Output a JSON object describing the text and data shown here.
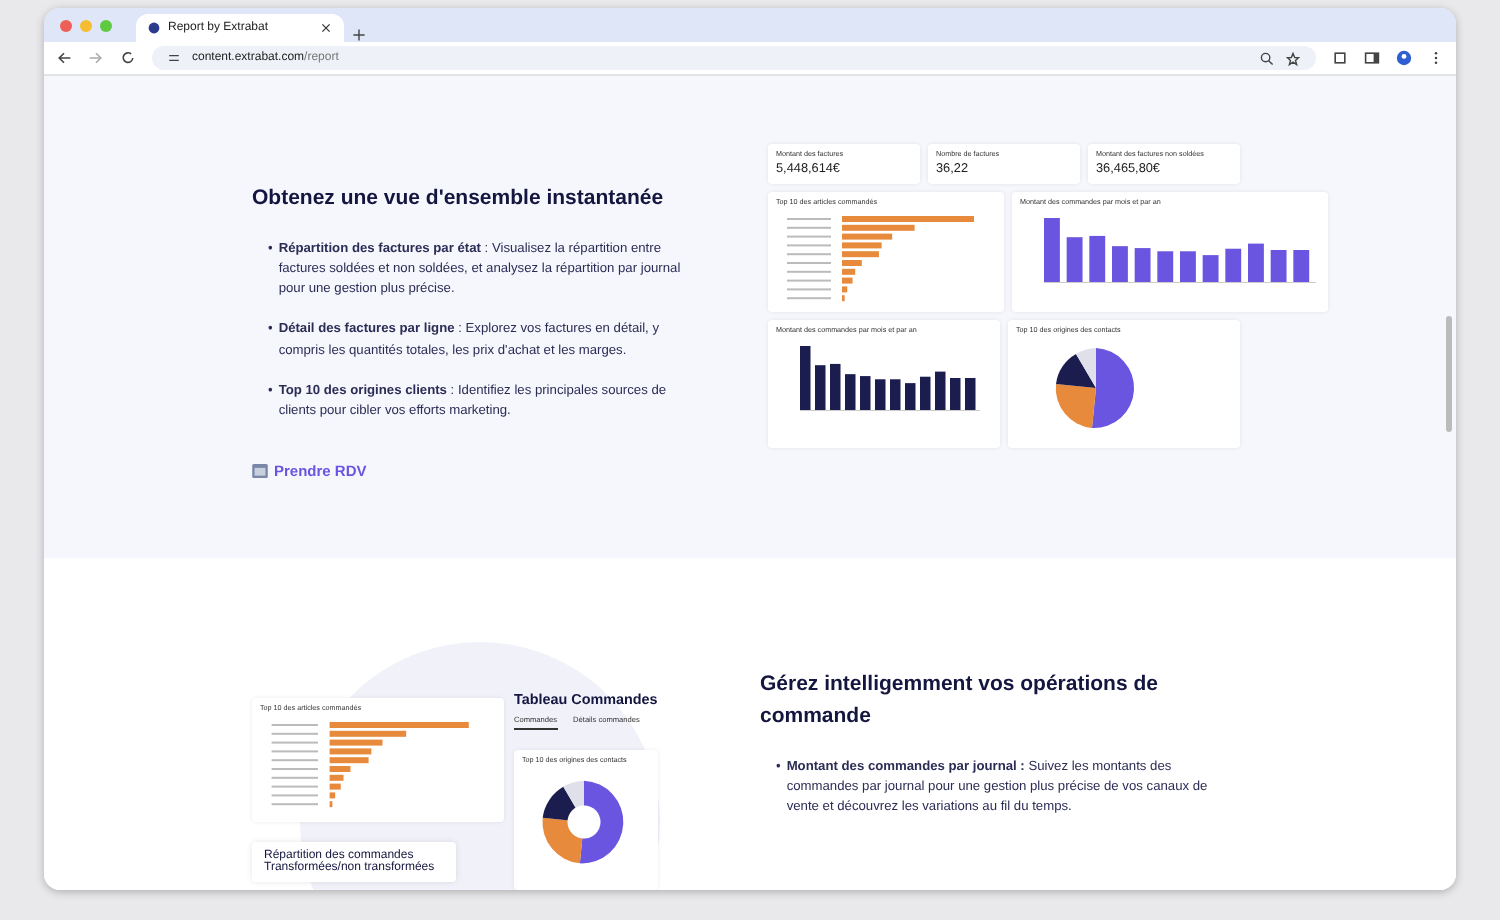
{
  "browser": {
    "tab_title": "Report by Extrabat",
    "url_host": "content.extrabat.com",
    "url_path": "/report"
  },
  "section1": {
    "title": "Obtenez une vue d'ensemble instantanée",
    "bullets": [
      {
        "marker": "•",
        "text": "**Répartition des factures par état** : Visualisez la répartition entre factures soldées et non soldées, et analysez la répartition par journal pour une gestion plus précise."
      },
      {
        "marker": "•",
        "text": "**Détail des factures par ligne** : Explorez vos factures en détail, y compris les quantités totales, les prix d'achat et les marges."
      },
      {
        "marker": "•",
        "text": "**Top 10 des origines clients** : Identifiez les principales sources de clients pour cibler vos efforts marketing."
      }
    ],
    "cta": "Prendre RDV",
    "dashboard": {
      "kpis": [
        {
          "label": "Montant des factures",
          "value": "5,448,614€"
        },
        {
          "label": "Nombre de factures",
          "value": "36,22"
        },
        {
          "label": "Montant des factures non soldées",
          "value": "36,465,80€"
        }
      ],
      "charts": [
        {
          "kind": "hbar",
          "title": "Top 10 des articles commandés"
        },
        {
          "kind": "vbar",
          "title": "Montant des commandes par mois et par an"
        },
        {
          "kind": "vbar_dark",
          "title": "Montant des commandes par mois et par an"
        },
        {
          "kind": "pie",
          "title": "Top 10 des origines des contacts"
        }
      ]
    }
  },
  "section2": {
    "title": "Gérez intelligemment vos opérations de commande",
    "bullets": [
      {
        "marker": "•",
        "text": "**Montant des commandes par journal :** Suivez les montants des commandes par journal pour une gestion plus précise de vos canaux de vente et découvrez les variations au fil du temps."
      }
    ],
    "preview": {
      "bar_chart_title": "Top 10 des articles commandés",
      "table_title": "Tableau Commandes",
      "tabs": [
        {
          "label": "Commandes",
          "selected": true
        },
        {
          "label": "Détails commandes",
          "selected": false
        }
      ],
      "donut_title": "Top 10 des origines des contacts",
      "card_title": "Répartition des commandes Transformées/non transformées"
    }
  }
}
